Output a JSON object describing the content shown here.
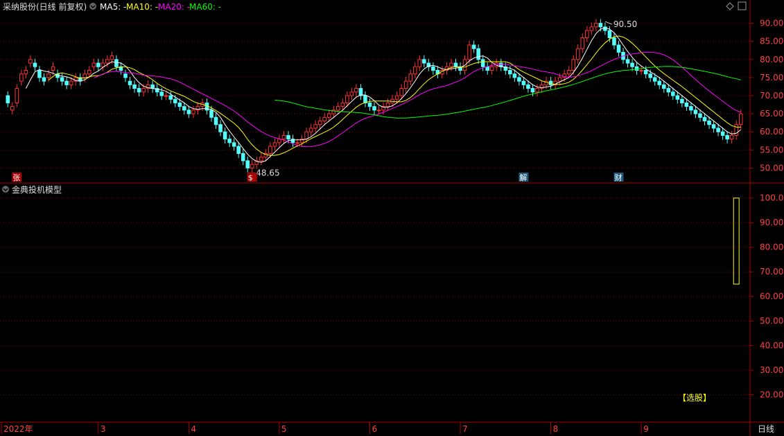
{
  "header": {
    "stock_name": "采纳股份(日线 前复权)",
    "ma5": "MA5: -",
    "ma10": "MA10: -",
    "ma20": "MA20: -",
    "ma60": "MA60: -"
  },
  "sub_panel": {
    "title": "金典投机模型",
    "signal_label": "【选股】"
  },
  "bottom": {
    "period_label": "日线"
  },
  "colors": {
    "background": "#000000",
    "grid": "#8b0000",
    "up": "#ff3333",
    "down": "#54ffff",
    "ma5": "#ffffff",
    "ma10": "#ffff00",
    "ma20": "#ff00ff",
    "ma60": "#00ff00",
    "signal": "#ffff00"
  },
  "chart_data": [
    {
      "type": "candlestick",
      "ylim": [
        47,
        93
      ],
      "yticks": [
        "90.00",
        "85.00",
        "80.00",
        "75.00",
        "70.00",
        "65.00",
        "60.00",
        "55.00",
        "50.00"
      ],
      "ytick_values": [
        90,
        85,
        80,
        75,
        70,
        65,
        60,
        55,
        50
      ],
      "x_labels": [
        "2022年",
        "3",
        "4",
        "5",
        "6",
        "7",
        "8",
        "9"
      ],
      "x_label_index": [
        0,
        20,
        40,
        60,
        80,
        100,
        120,
        140
      ],
      "max_annotation": {
        "label": "90.50",
        "index": 132,
        "value": 90.5
      },
      "min_annotation": {
        "label": "48.65",
        "index": 53,
        "value": 48.65
      },
      "event_markers": [
        {
          "text": "张",
          "index": 2
        },
        {
          "text": "$",
          "index": 54
        },
        {
          "text": "解",
          "index": 114
        },
        {
          "text": "财",
          "index": 135
        }
      ],
      "closes": [
        68,
        67,
        72,
        76,
        77,
        80,
        78,
        75,
        74,
        76,
        78,
        75,
        74,
        73,
        74,
        75,
        74,
        76,
        77,
        79,
        78,
        79,
        80,
        81,
        78,
        77,
        75,
        73,
        72,
        71,
        72,
        73,
        72,
        71,
        70,
        70,
        69,
        68,
        67,
        66,
        65,
        66,
        67,
        68,
        66,
        64,
        62,
        60,
        58,
        57,
        56,
        54,
        52,
        50,
        51,
        52,
        53,
        54,
        56,
        57,
        58,
        59,
        58,
        57,
        57,
        58,
        60,
        61,
        62,
        63,
        64,
        65,
        66,
        67,
        68,
        70,
        71,
        72,
        70,
        68,
        67,
        66,
        66,
        67,
        68,
        69,
        70,
        72,
        74,
        76,
        78,
        80,
        79,
        78,
        77,
        76,
        77,
        78,
        79,
        78,
        77,
        80,
        84,
        83,
        80,
        78,
        77,
        78,
        79,
        78,
        77,
        76,
        75,
        74,
        73,
        72,
        71,
        72,
        73,
        74,
        73,
        74,
        75,
        76,
        77,
        80,
        83,
        86,
        88,
        89,
        90,
        89,
        88,
        86,
        84,
        82,
        80,
        79,
        78,
        77,
        77,
        76,
        75,
        74,
        73,
        72,
        71,
        70,
        69,
        68,
        67,
        66,
        65,
        64,
        63,
        62,
        61,
        60,
        59,
        58,
        59,
        62,
        65
      ],
      "opens": [
        70,
        66,
        68,
        74,
        76,
        79,
        79,
        77,
        75,
        75,
        77,
        76,
        75,
        74,
        73,
        74,
        75,
        75,
        76,
        78,
        79,
        78,
        79,
        80,
        80,
        78,
        76,
        74,
        73,
        72,
        71,
        72,
        73,
        72,
        71,
        70,
        70,
        69,
        68,
        67,
        66,
        65,
        66,
        67,
        68,
        66,
        64,
        62,
        60,
        58,
        57,
        56,
        54,
        52,
        50,
        51,
        52,
        53,
        54,
        56,
        57,
        58,
        59,
        58,
        57,
        57,
        58,
        60,
        61,
        62,
        63,
        64,
        65,
        66,
        67,
        68,
        70,
        71,
        72,
        70,
        68,
        67,
        66,
        66,
        67,
        68,
        69,
        70,
        72,
        74,
        76,
        78,
        80,
        79,
        78,
        77,
        76,
        77,
        78,
        79,
        78,
        77,
        80,
        84,
        83,
        80,
        78,
        77,
        78,
        79,
        78,
        77,
        76,
        75,
        74,
        73,
        72,
        71,
        72,
        73,
        74,
        73,
        74,
        75,
        76,
        77,
        80,
        83,
        86,
        88,
        89,
        90,
        89,
        88,
        86,
        84,
        82,
        80,
        79,
        78,
        77,
        77,
        76,
        75,
        74,
        73,
        72,
        71,
        70,
        69,
        68,
        67,
        66,
        65,
        64,
        63,
        62,
        61,
        60,
        59,
        58,
        59,
        62
      ]
    },
    {
      "type": "bar",
      "ylim": [
        10,
        105
      ],
      "yticks": [
        "100.0",
        "90.00",
        "80.00",
        "70.00",
        "60.00",
        "50.00",
        "40.00",
        "30.00",
        "20.00"
      ],
      "ytick_values": [
        100,
        90,
        80,
        70,
        60,
        50,
        40,
        30,
        20
      ],
      "signal_bar": {
        "index": 161,
        "bottom": 65,
        "top": 100
      }
    }
  ]
}
